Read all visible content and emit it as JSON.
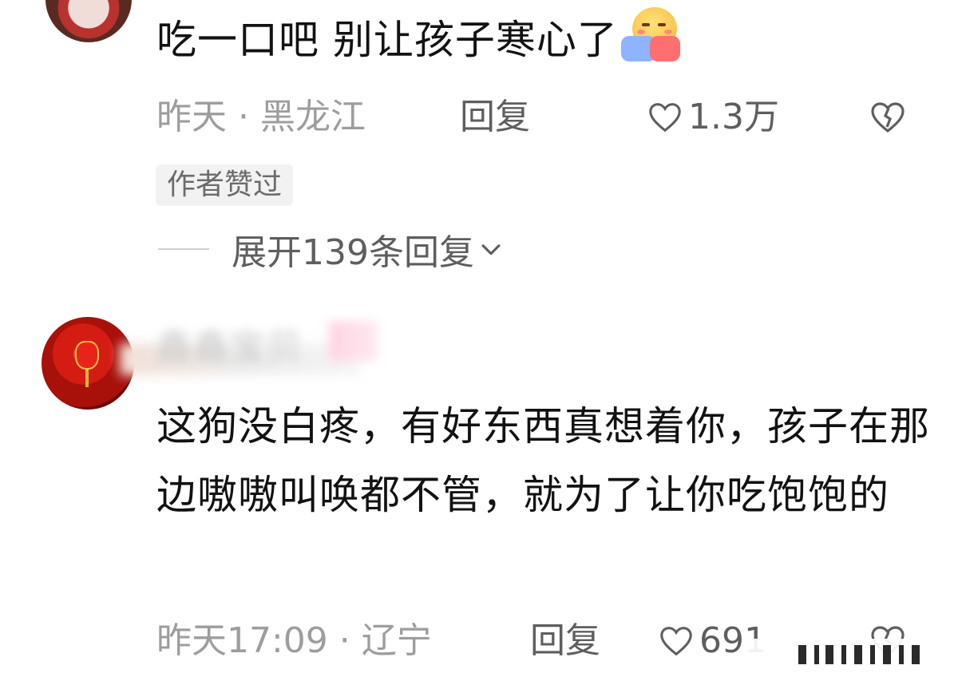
{
  "comments": [
    {
      "text": "吃一口吧 别让孩子寒心了",
      "emoji": "hugging-face-emoji",
      "meta": "昨天 · 黑龙江",
      "reply_label": "回复",
      "likes": "1.3万",
      "badge": "作者赞过",
      "expand_label": "展开139条回复"
    },
    {
      "username": "鑫鑫宝贝",
      "text": "这狗没白疼，有好东西真想着你，孩子在那边嗷嗷叫唤都不管，就为了让你吃饱饱的",
      "meta": "昨天17:09 · 辽宁",
      "reply_label": "回复",
      "likes": "691"
    }
  ],
  "icons": {
    "like": "heart-outline-icon",
    "dislike": "broken-heart-icon",
    "expand": "chevron-down-icon"
  },
  "colors": {
    "text": "#121212",
    "meta": "#9d9d9d",
    "action": "#5e5e5e",
    "badge_bg": "#f2f2f2"
  }
}
